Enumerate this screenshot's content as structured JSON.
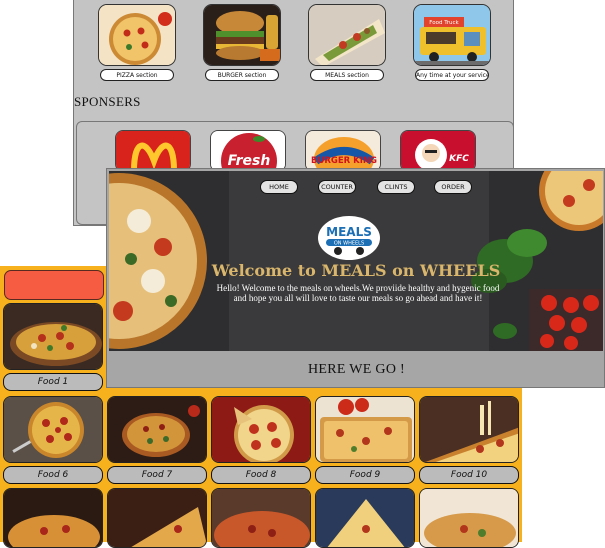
{
  "sections": {
    "items": [
      {
        "label": "PIZZA section",
        "icon": "pizza-image"
      },
      {
        "label": "BURGER section",
        "icon": "burger-image"
      },
      {
        "label": "MEALS section",
        "icon": "wrap-image"
      },
      {
        "label": "Any time at your service",
        "icon": "food-truck-image",
        "sign": "Food Truck"
      }
    ]
  },
  "sponsors": {
    "title": "SPONSERS",
    "items": [
      {
        "name": "mcdonalds",
        "color": "#d8231c"
      },
      {
        "name": "Fresh",
        "color": "#c8202e"
      },
      {
        "name": "BURGER KING",
        "color": "#1757a8"
      },
      {
        "name": "KFC",
        "color": "#c8102e"
      }
    ]
  },
  "hero": {
    "nav": [
      "HOME",
      "COUNTER",
      "CLINTS",
      "ORDER"
    ],
    "logo_text": "MEALS",
    "logo_sub": "ON WHEELS",
    "title": "Welcome to MEALS on WHEELS",
    "text": "Hello! Welcome to the meals on wheels.We proviide healthy and hygenic food and hope you all will love to taste our meals so go ahead and have it!",
    "cta": "HERE WE GO !"
  },
  "foods": {
    "row1": [
      {
        "label": "Food 1"
      }
    ],
    "row2": [
      {
        "label": "Food 6"
      },
      {
        "label": "Food 7"
      },
      {
        "label": "Food 8"
      },
      {
        "label": "Food 9"
      },
      {
        "label": "Food 10"
      }
    ]
  },
  "colors": {
    "orange": "#f7b11c",
    "red": "#f65c42",
    "gray": "#c4c4c4",
    "gold": "#d9b66b"
  }
}
